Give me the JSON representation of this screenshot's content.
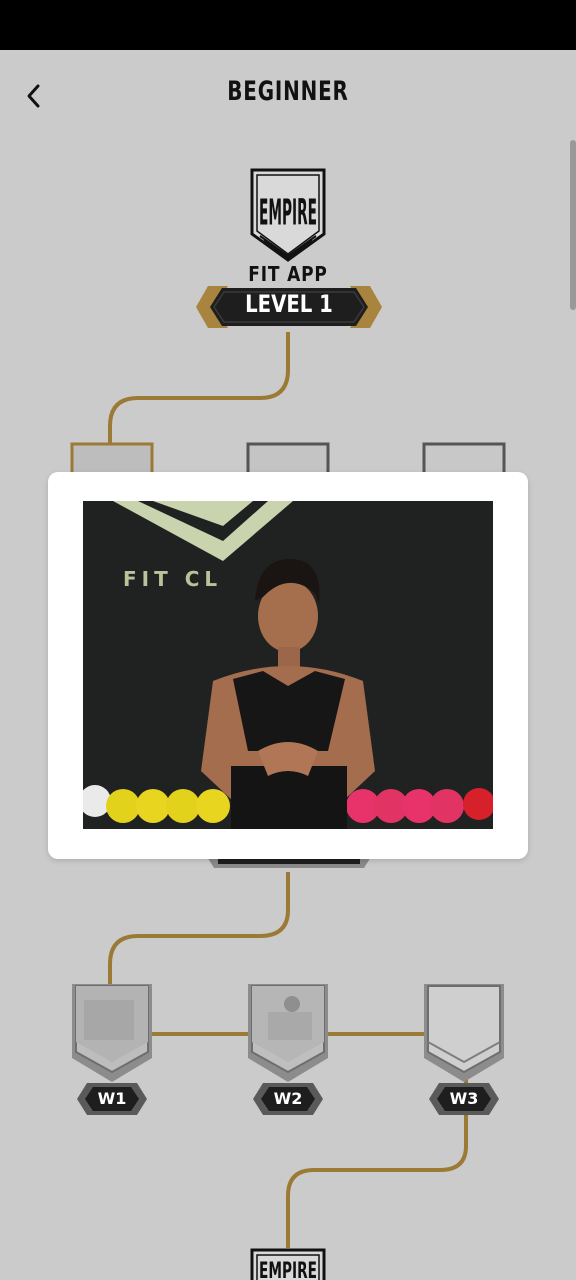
{
  "header": {
    "title": "BEGINNER",
    "back_icon": "chevron-left-icon"
  },
  "program": {
    "logo_text": "EMPIRE",
    "app_label": "FIT APP",
    "level_label": "LEVEL 1"
  },
  "weeks": [
    {
      "label": "W1"
    },
    {
      "label": "W2"
    },
    {
      "label": "W3"
    }
  ],
  "video": {
    "sign_text": "FIT CL"
  },
  "colors": {
    "background": "#cbcbcb",
    "path_gold": "#9b7a35",
    "badge_dark": "#1e1e1e",
    "badge_gold": "#a8843e",
    "pill_gray": "#5a5a5a"
  }
}
